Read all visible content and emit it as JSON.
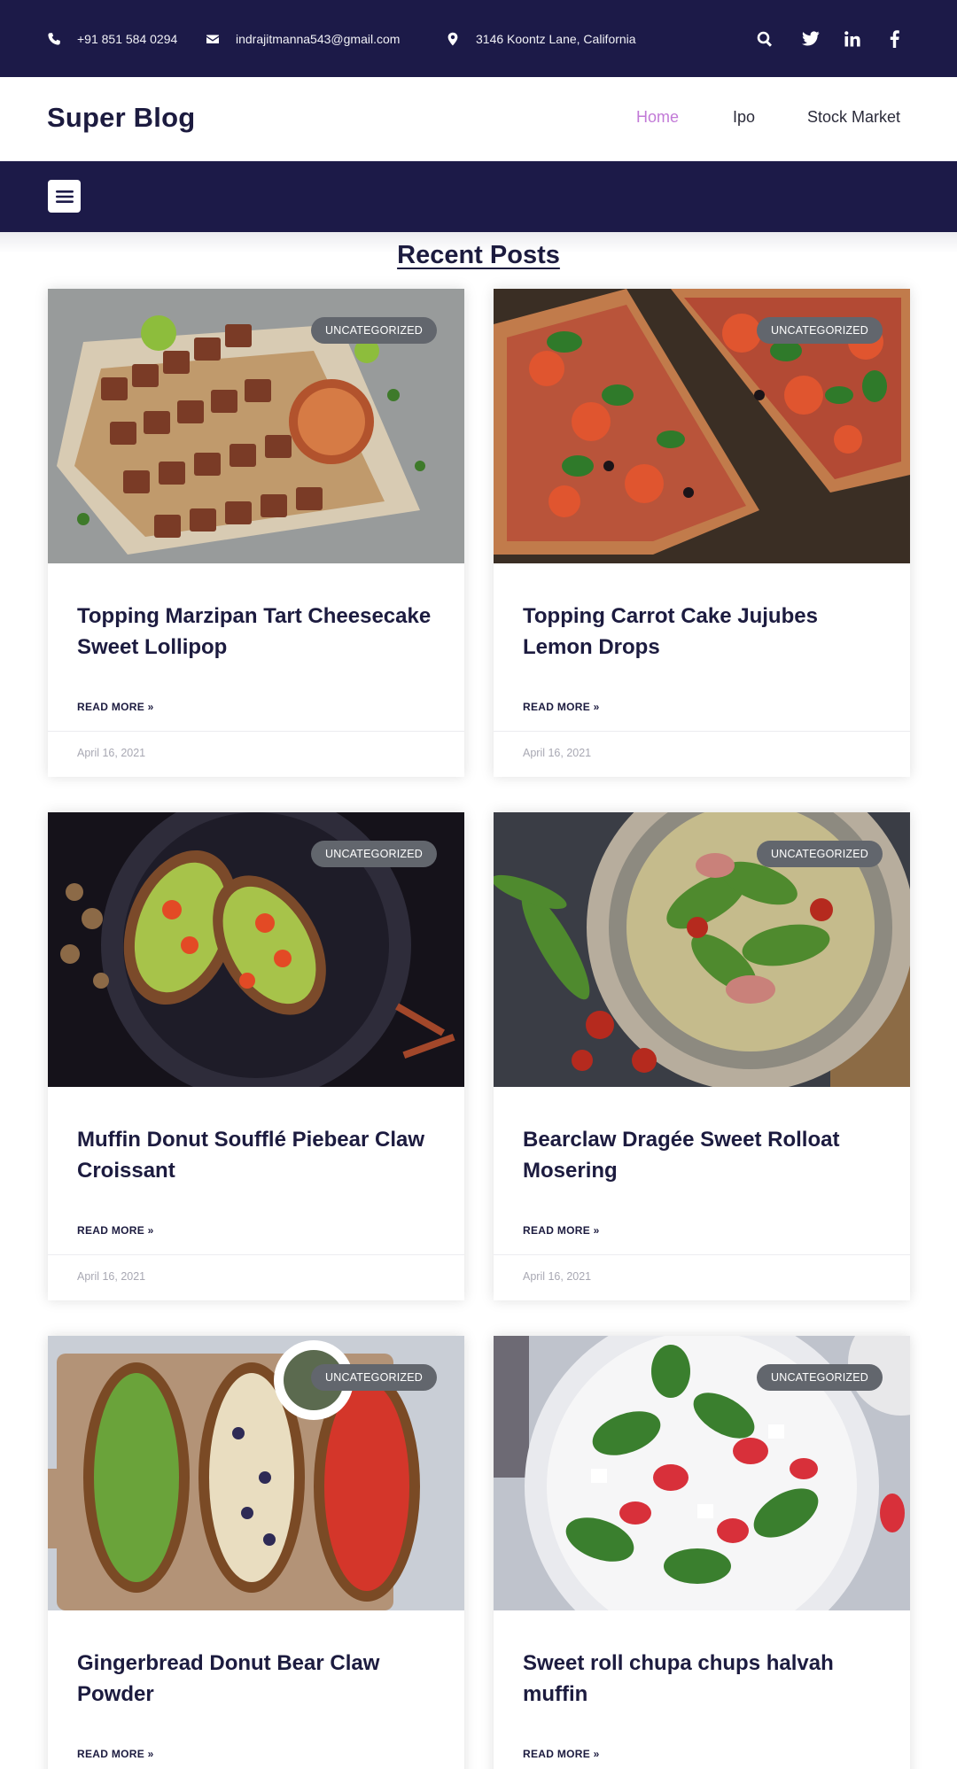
{
  "topbar": {
    "phone": "+91 851 584 0294",
    "email": "indrajitmanna543@gmail.com",
    "address": "3146 Koontz Lane, California",
    "icons": [
      "phone-icon",
      "envelope-icon",
      "map-marker-icon",
      "search-icon",
      "twitter-icon",
      "linkedin-icon",
      "facebook-icon"
    ]
  },
  "header": {
    "brand": "Super Blog",
    "nav": [
      "Home",
      "Ipo",
      "Stock Market"
    ],
    "active_nav": "Home"
  },
  "menu_toggle_icon": "hamburger-icon",
  "section": {
    "title": "Recent Posts"
  },
  "posts": [
    {
      "category": "UNCATEGORIZED",
      "title": "Topping Marzipan Tart Cheesecake Sweet Lollipop",
      "read_more": "READ MORE »",
      "date": "April 16, 2021",
      "image": "skewers-with-dip"
    },
    {
      "category": "UNCATEGORIZED",
      "title": "Topping Carrot Cake Jujubes Lemon Drops",
      "read_more": "READ MORE »",
      "date": "April 16, 2021",
      "image": "pizza-slices"
    },
    {
      "category": "UNCATEGORIZED",
      "title": "Muffin Donut Soufflé Piebear Claw Croissant",
      "read_more": "READ MORE »",
      "date": "April 16, 2021",
      "image": "avocado-toast-dark-plate"
    },
    {
      "category": "UNCATEGORIZED",
      "title": "Bearclaw Dragée Sweet Rolloat Mosering",
      "read_more": "READ MORE »",
      "date": "April 16, 2021",
      "image": "arugula-salad-plate"
    },
    {
      "category": "UNCATEGORIZED",
      "title": "Gingerbread Donut Bear Claw Powder",
      "read_more": "READ MORE »",
      "date": "",
      "image": "open-sandwiches-board"
    },
    {
      "category": "UNCATEGORIZED",
      "title": "Sweet roll chupa chups halvah muffin",
      "read_more": "READ MORE »",
      "date": "",
      "image": "strawberry-spinach-salad"
    }
  ],
  "colors": {
    "navy": "#1c1a48",
    "nav_active": "#c27ad7",
    "badge": "#62666d",
    "date_text": "#a8a8b3"
  }
}
